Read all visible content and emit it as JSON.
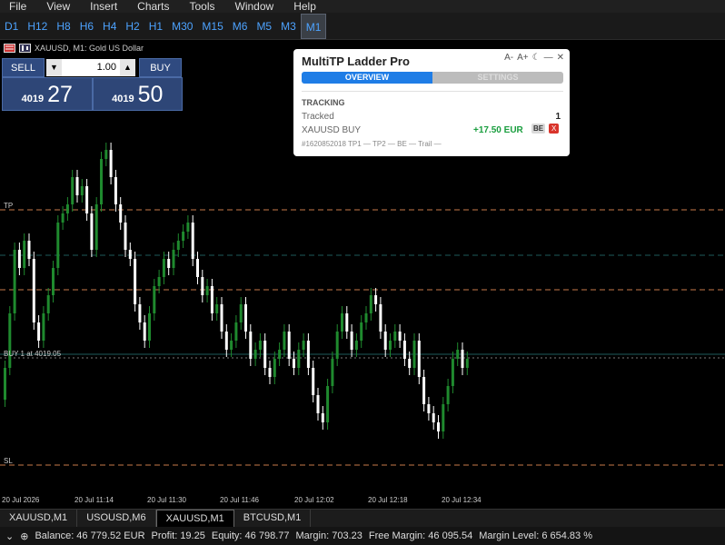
{
  "menu": [
    "File",
    "View",
    "Insert",
    "Charts",
    "Tools",
    "Window",
    "Help"
  ],
  "timeframes": [
    "D1",
    "H12",
    "H8",
    "H6",
    "H4",
    "H2",
    "H1",
    "M30",
    "M15",
    "M6",
    "M5",
    "M3",
    "M1"
  ],
  "active_timeframe": "M1",
  "chart": {
    "symbol_title": "XAUUSD, M1:  Gold US Dollar",
    "line_labels": {
      "tp": "TP",
      "buy": "BUY 1 at 4019.05",
      "sl": "SL"
    },
    "time_labels": [
      "20 Jul 2026",
      "20 Jul 11:14",
      "20 Jul 11:30",
      "20 Jul 11:46",
      "20 Jul 12:02",
      "20 Jul 12:18",
      "20 Jul 12:34"
    ],
    "colors": {
      "bull": "#1f8a2e",
      "bear": "#ffffff",
      "tp_line": "#c87a4a",
      "sl_line": "#c87a4a",
      "entry_line": "#1e5a5a"
    }
  },
  "one_click": {
    "sell_label": "SELL",
    "buy_label": "BUY",
    "lot": "1.00",
    "down_glyph": "▼",
    "up_glyph": "▲",
    "sell_price_small": "4019",
    "sell_price_big": "27",
    "buy_price_small": "4019",
    "buy_price_big": "50"
  },
  "panel": {
    "title": "MultiTP Ladder Pro",
    "controls": [
      "A-",
      "A+",
      "☾",
      "—",
      "✕"
    ],
    "tab_overview": "OVERVIEW",
    "tab_other": "SETTINGS",
    "section": "TRACKING",
    "tracked_label": "Tracked",
    "tracked_value": "1",
    "position_label": "XAUUSD BUY",
    "position_profit": "+17.50 EUR",
    "be_label": "BE",
    "close_label": "X",
    "ticket_line": "#1620852018   TP1 —   TP2 —   BE —   Trail —"
  },
  "tabs": [
    "XAUUSD,M1",
    "USOUSD,M6",
    "XAUUSD,M1",
    "BTCUSD,M1"
  ],
  "active_tab_index": 2,
  "status": {
    "balance": "Balance: 46 779.52 EUR",
    "profit": "Profit: 19.25",
    "equity": "Equity: 46 798.77",
    "margin": "Margin: 703.23",
    "free_margin": "Free Margin: 46 095.54",
    "margin_level": "Margin Level: 6 654.83 %"
  }
}
